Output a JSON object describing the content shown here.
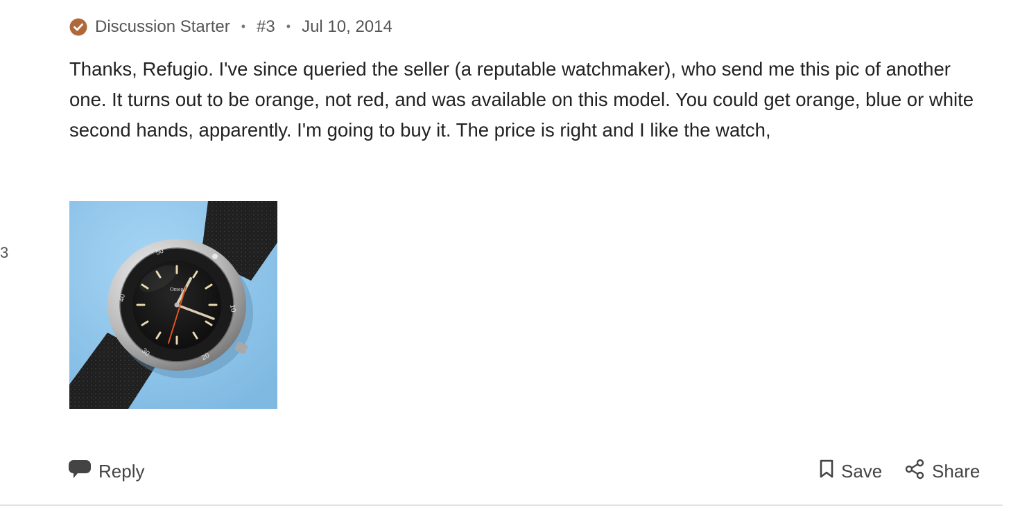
{
  "side": {
    "count": "3"
  },
  "post": {
    "badge_label": "Discussion Starter",
    "number": "#3",
    "date": "Jul 10, 2014",
    "body": "Thanks, Refugio. I've since queried the seller (a reputable watchmaker), who send me this pic of another one. It turns out to be orange, not red, and was available on this model. You could get orange, blue or white second hands, apparently. I'm going to buy it. The price is right and I like the watch,",
    "attachment": {
      "bezel_numbers": [
        "50",
        "40",
        "30",
        "20",
        "10"
      ],
      "dial_text": "Omega"
    }
  },
  "actions": {
    "reply_label": "Reply",
    "save_label": "Save",
    "share_label": "Share"
  },
  "colors": {
    "badge": "#b0683a",
    "text": "#222222",
    "muted": "#555555",
    "photo_background": "#8ec6ec",
    "second_hand": "#e2541f"
  },
  "icons": {
    "badge": "check-circle-icon",
    "reply": "speech-bubble-icon",
    "save": "bookmark-icon",
    "share": "share-nodes-icon"
  }
}
